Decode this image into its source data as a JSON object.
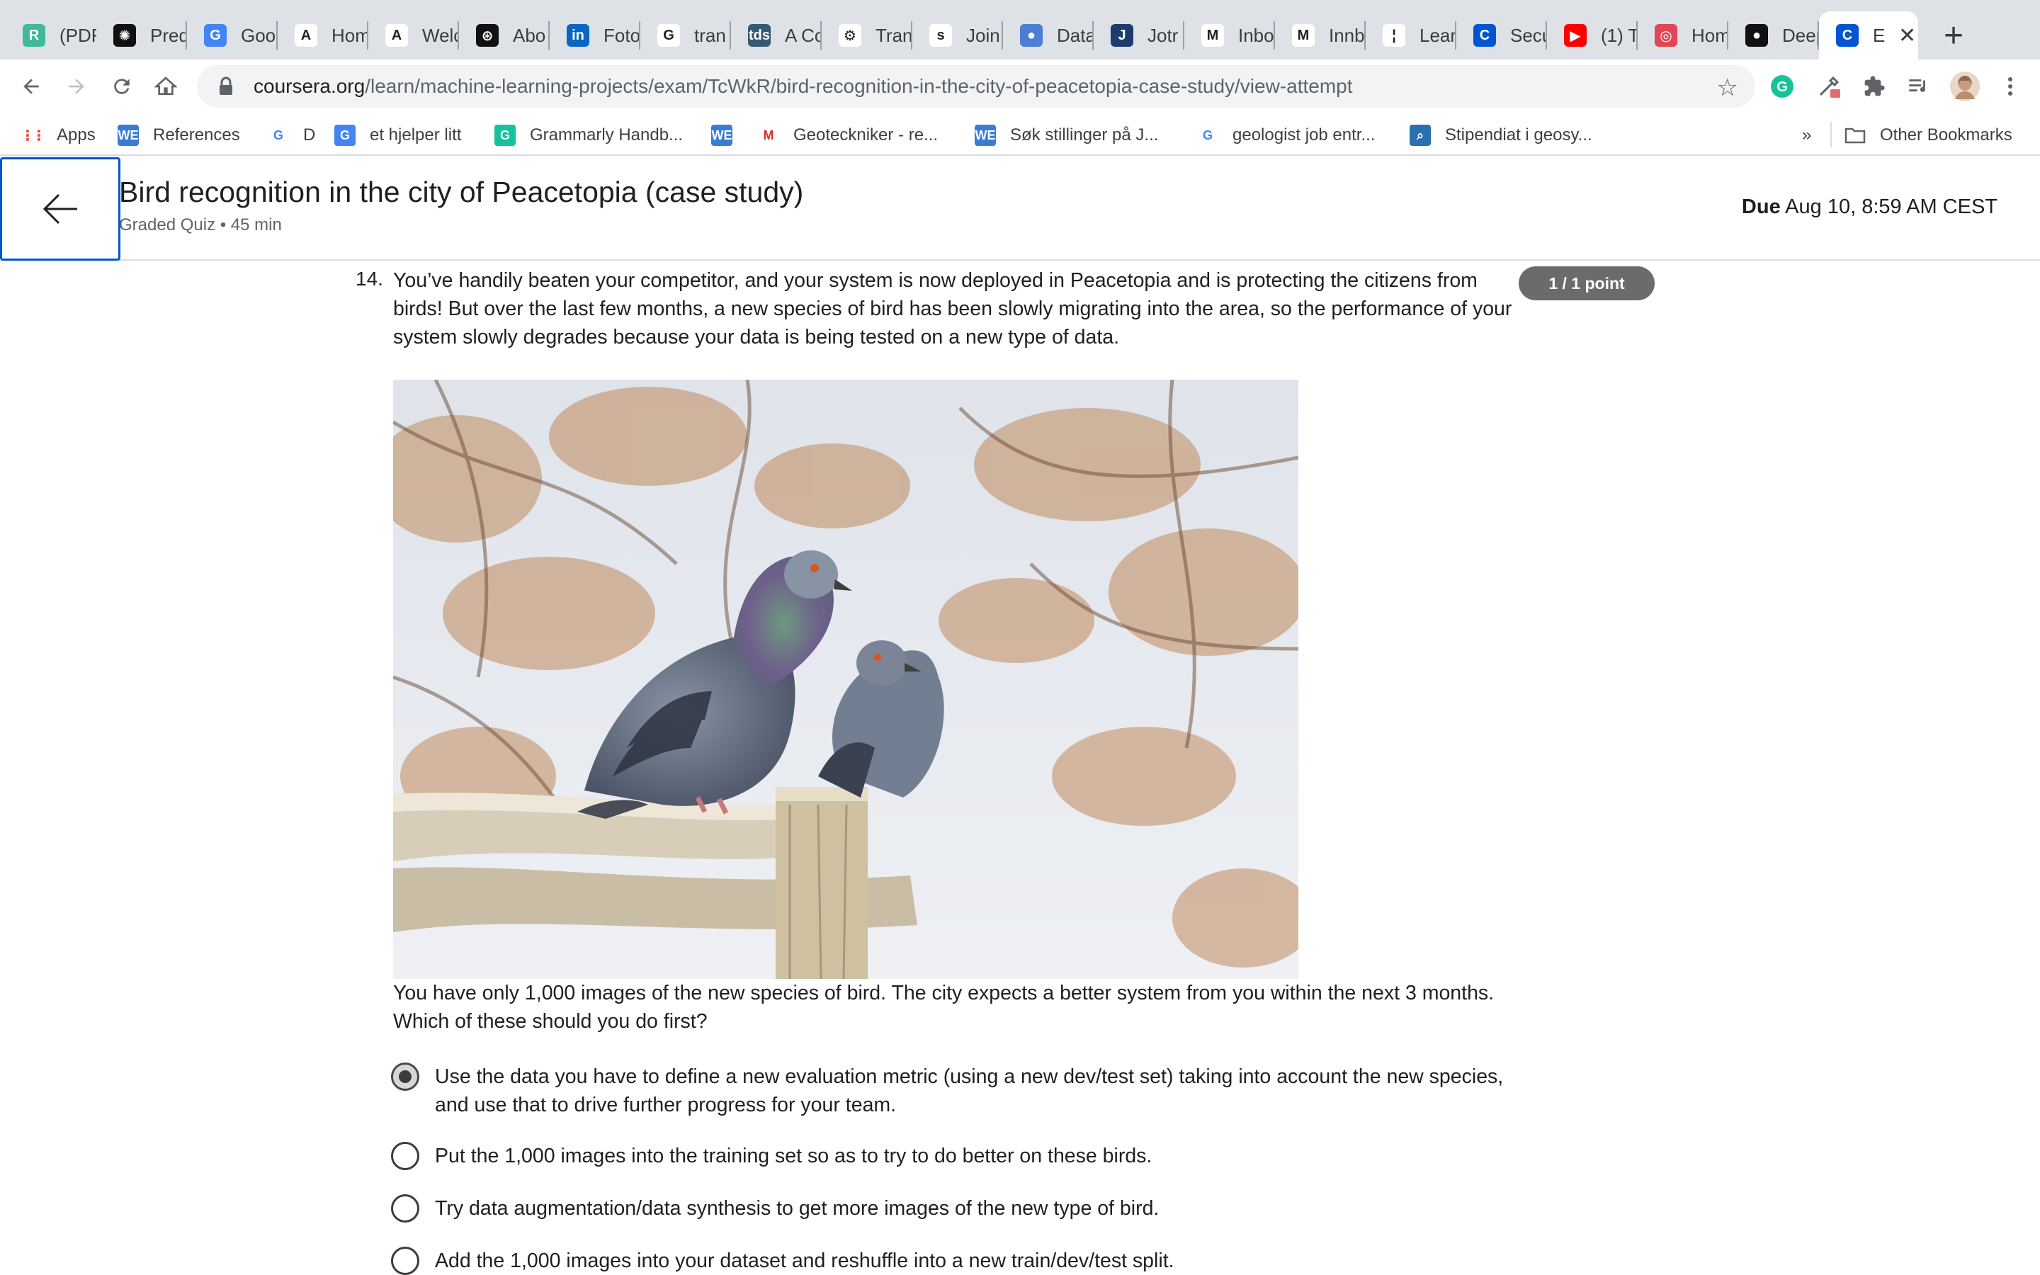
{
  "browser": {
    "tabs": [
      {
        "label": "(PDF",
        "icon": "researchgate-icon",
        "color": "#40ba9b",
        "glyph": "R"
      },
      {
        "label": "Pred",
        "icon": "gear-icon",
        "color": "#111111",
        "glyph": "✺"
      },
      {
        "label": "Goo",
        "icon": "google-translate-icon",
        "color": "#4285f4",
        "glyph": "G"
      },
      {
        "label": "Hom",
        "icon": "a-letter-icon",
        "color": "#ffffff",
        "glyph": "A"
      },
      {
        "label": "Welc",
        "icon": "a-letter-icon",
        "color": "#ffffff",
        "glyph": "A"
      },
      {
        "label": "Abo",
        "icon": "openai-icon",
        "color": "#111111",
        "glyph": "⊛"
      },
      {
        "label": "Foto",
        "icon": "linkedin-icon",
        "color": "#0a66c2",
        "glyph": "in"
      },
      {
        "label": "tran",
        "icon": "google-icon",
        "color": "#ffffff",
        "glyph": "G"
      },
      {
        "label": "A Co",
        "icon": "tds-icon",
        "color": "#355876",
        "glyph": "tds"
      },
      {
        "label": "Tran",
        "icon": "robot-icon",
        "color": "#ffffff",
        "glyph": "⚙"
      },
      {
        "label": "Join",
        "icon": "s-letter-icon",
        "color": "#ffffff",
        "glyph": "s"
      },
      {
        "label": "Data",
        "icon": "drop-icon",
        "color": "#4a7fd4",
        "glyph": "●"
      },
      {
        "label": "Jotr",
        "icon": "j-letter-icon",
        "color": "#1d3b6e",
        "glyph": "J"
      },
      {
        "label": "Inbo",
        "icon": "gmail-icon",
        "color": "#ffffff",
        "glyph": "M"
      },
      {
        "label": "Innb",
        "icon": "gmail-icon",
        "color": "#ffffff",
        "glyph": "M"
      },
      {
        "label": "Lear",
        "icon": "bars-icon",
        "color": "#ffffff",
        "glyph": "¦"
      },
      {
        "label": "Secu",
        "icon": "coursera-icon",
        "color": "#0056d2",
        "glyph": "C"
      },
      {
        "label": "(1) T",
        "icon": "youtube-icon",
        "color": "#ff0000",
        "glyph": "▶"
      },
      {
        "label": "Hom",
        "icon": "target-icon",
        "color": "#e04657",
        "glyph": "◎"
      },
      {
        "label": "Deep",
        "icon": "github-icon",
        "color": "#111111",
        "glyph": "●"
      },
      {
        "label": "E",
        "icon": "coursera-icon",
        "color": "#0056d2",
        "glyph": "C"
      }
    ],
    "url_host": "coursera.org",
    "url_path": "/learn/machine-learning-projects/exam/TcWkR/bird-recognition-in-the-city-of-peacetopia-case-study/view-attempt",
    "bookmarks": [
      {
        "label": "Apps",
        "icon": "apps-grid-icon"
      },
      {
        "label": "References",
        "icon": "we-icon"
      },
      {
        "label": "D",
        "icon": "google-icon"
      },
      {
        "label": "et hjelper litt",
        "icon": "google-translate-icon"
      },
      {
        "label": "Grammarly Handb...",
        "icon": "grammarly-icon"
      },
      {
        "label": "",
        "icon": "we-icon"
      },
      {
        "label": "Geoteckniker - re...",
        "icon": "gmail-icon"
      },
      {
        "label": "Søk stillinger på J...",
        "icon": "we-icon"
      },
      {
        "label": "geologist job entr...",
        "icon": "google-icon"
      },
      {
        "label": "Stipendiat i geosy...",
        "icon": "search-doc-icon"
      }
    ],
    "bookmarks_more": "»",
    "other_bookmarks": "Other Bookmarks"
  },
  "quiz": {
    "title": "Bird recognition in the city of Peacetopia (case study)",
    "subtitle": "Graded Quiz • 45 min",
    "due_label": "Due",
    "due_value": "Aug 10, 8:59 AM CEST"
  },
  "question": {
    "number": "14.",
    "text": "You’ve handily beaten your competitor, and your system is now deployed in Peacetopia and is protecting the citizens from birds! But over the last few months, a new species of bird has been slowly migrating into the area, so the performance of your system slowly degrades because your data is being tested on a new type of data.",
    "points": "1 / 1 point",
    "image_subject": "two pigeons perched on a wooden fence",
    "followup": "You have only 1,000 images of the new species of bird. The city expects a better system from you within the next 3 months. Which of these should you do first?",
    "options": [
      {
        "label": "Use the data you have to define a new evaluation metric (using a new dev/test set) taking into account the new species, and use that to drive further progress for your team.",
        "selected": true
      },
      {
        "label": "Put the 1,000 images into the training set so as to try to do better on these birds.",
        "selected": false
      },
      {
        "label": "Try data augmentation/data synthesis to get more images of the new type of bird.",
        "selected": false
      },
      {
        "label": "Add the 1,000 images into your dataset and reshuffle into a new train/dev/test split.",
        "selected": false
      }
    ]
  },
  "colors": {
    "accent": "#0056d2",
    "points_badge": "#6b6b6b",
    "tabstrip": "#dee1e6"
  }
}
